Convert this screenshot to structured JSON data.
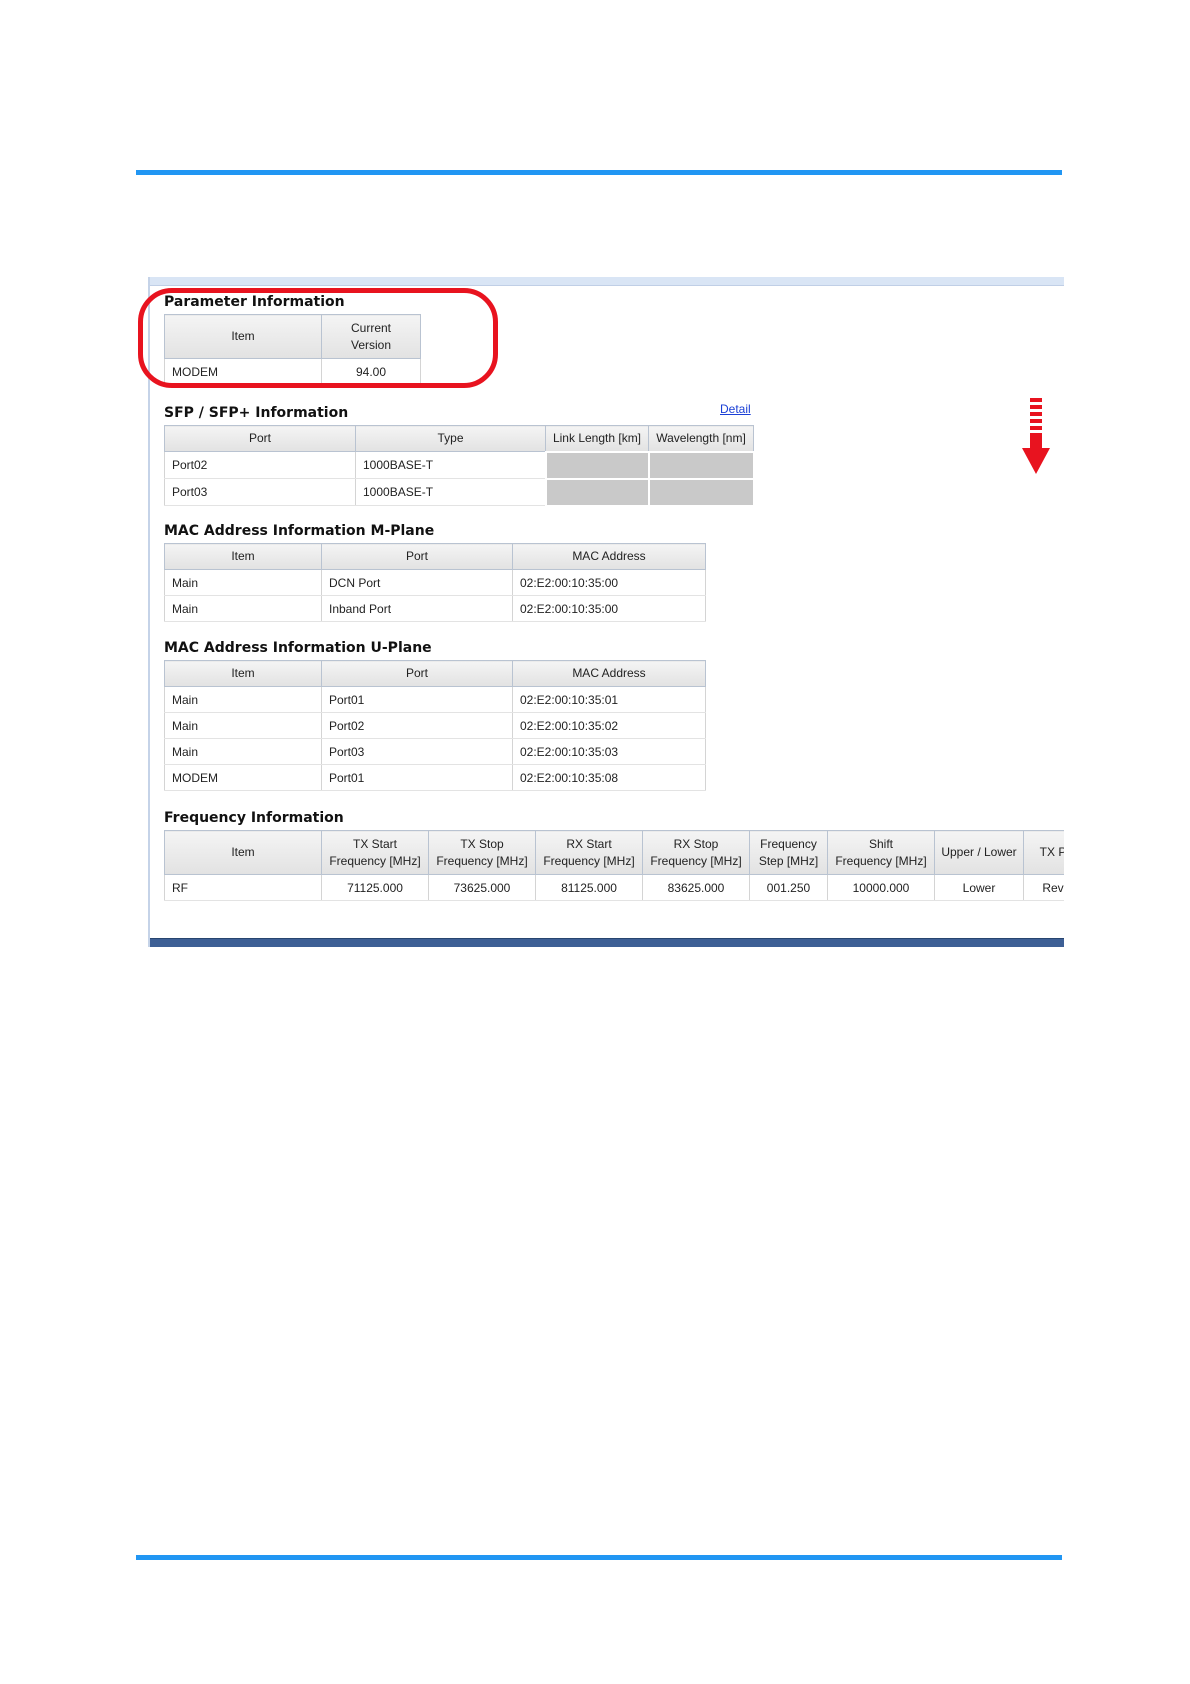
{
  "colors": {
    "rule": "#2196f3",
    "highlight": "#e8131f",
    "arrow": "#e8131f",
    "link": "#1a3fd6"
  },
  "annotation": {
    "highlight_target": "parameter-information-section",
    "arrow_icon": "scroll-down-arrow-icon"
  },
  "parameter_info": {
    "title": "Parameter Information",
    "headers": [
      "Item",
      "Current\nVersion"
    ],
    "rows": [
      [
        "MODEM",
        "94.00"
      ]
    ]
  },
  "sfp_info": {
    "title": "SFP / SFP+ Information",
    "detail_link": "Detail",
    "headers": [
      "Port",
      "Type",
      "Link Length [km]",
      "Wavelength [nm]"
    ],
    "rows": [
      [
        "Port02",
        "1000BASE-T",
        "",
        ""
      ],
      [
        "Port03",
        "1000BASE-T",
        "",
        ""
      ]
    ]
  },
  "mac_mplane": {
    "title": "MAC Address Information M-Plane",
    "headers": [
      "Item",
      "Port",
      "MAC Address"
    ],
    "rows": [
      [
        "Main",
        "DCN Port",
        "02:E2:00:10:35:00"
      ],
      [
        "Main",
        "Inband Port",
        "02:E2:00:10:35:00"
      ]
    ]
  },
  "mac_uplane": {
    "title": "MAC Address Information U-Plane",
    "headers": [
      "Item",
      "Port",
      "MAC Address"
    ],
    "rows": [
      [
        "Main",
        "Port01",
        "02:E2:00:10:35:01"
      ],
      [
        "Main",
        "Port02",
        "02:E2:00:10:35:02"
      ],
      [
        "Main",
        "Port03",
        "02:E2:00:10:35:03"
      ],
      [
        "MODEM",
        "Port01",
        "02:E2:00:10:35:08"
      ]
    ]
  },
  "frequency_info": {
    "title": "Frequency Information",
    "headers": [
      "Item",
      "TX Start\nFrequency [MHz]",
      "TX Stop\nFrequency [MHz]",
      "RX Start\nFrequency [MHz]",
      "RX Stop\nFrequency [MHz]",
      "Frequency\nStep [MHz]",
      "Shift\nFrequency [MHz]",
      "Upper / Lower",
      "TX P"
    ],
    "rows": [
      [
        "RF",
        "71125.000",
        "73625.000",
        "81125.000",
        "83625.000",
        "001.250",
        "10000.000",
        "Lower",
        "Rev"
      ]
    ]
  }
}
